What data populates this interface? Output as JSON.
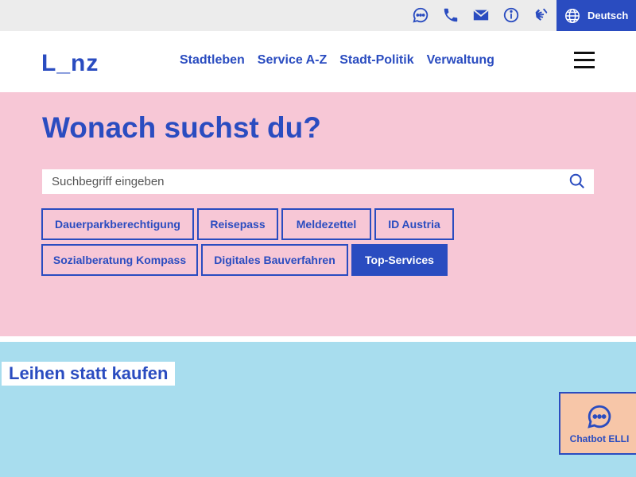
{
  "utility": {
    "icons": [
      "chat-icon",
      "phone-icon",
      "mail-icon",
      "info-icon",
      "sign-language-icon"
    ],
    "language_label": "Deutsch"
  },
  "header": {
    "logo": "L_nz",
    "nav": [
      "Stadtleben",
      "Service A-Z",
      "Stadt-Politik",
      "Verwaltung"
    ]
  },
  "search": {
    "title": "Wonach suchst du?",
    "placeholder": "Suchbegriff eingeben",
    "chips": [
      "Dauerparkberechtigung",
      "Reisepass",
      "Meldezettel",
      "ID Austria",
      "Sozialberatung Kompass",
      "Digitales Bauverfahren",
      "Top-Services"
    ]
  },
  "hero": {
    "title": "Leihen statt kaufen"
  },
  "chatbot": {
    "label": "Chatbot ELLI"
  },
  "colors": {
    "brand_blue": "#2a4cc0",
    "pink": "#f7c7d6",
    "light_blue": "#a8ddee",
    "peach": "#f7c6a8"
  }
}
